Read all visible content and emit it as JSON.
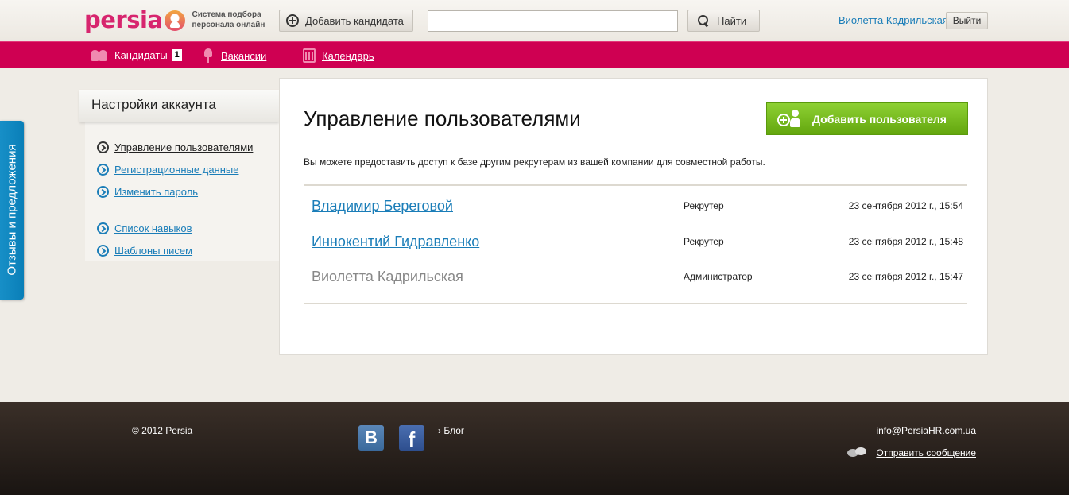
{
  "header": {
    "logo_text": "persia",
    "tagline_line1": "Система подбора",
    "tagline_line2": "персонала онлайн",
    "add_candidate_label": "Добавить кандидата",
    "search_value": "",
    "search_button_label": "Найти",
    "user_name": "Виолетта Кадрильская",
    "logout_label": "Выйти"
  },
  "nav": {
    "items": [
      {
        "label": "Кандидаты",
        "icon": "people-icon",
        "badge": "1"
      },
      {
        "label": "Вакансии",
        "icon": "chair-icon"
      },
      {
        "label": "Календарь",
        "icon": "calendar-icon"
      }
    ]
  },
  "feedback_tab": "Отзывы и предложения",
  "sidebar": {
    "title": "Настройки аккаунта",
    "items": [
      {
        "label": "Управление пользователями",
        "current": true
      },
      {
        "label": "Регистрационные данные"
      },
      {
        "label": "Изменить пароль"
      },
      {
        "label": "Список навыков"
      },
      {
        "label": "Шаблоны писем"
      }
    ]
  },
  "main": {
    "title": "Управление пользователями",
    "add_user_label": "Добавить пользователя",
    "intro": "Вы можете предоставить доступ к базе другим рекрутерам из вашей компании для совместной работы.",
    "users": [
      {
        "name": "Владимир Береговой",
        "role": "Рекрутер",
        "date": "23 сентября 2012 г., 15:54"
      },
      {
        "name": "Иннокентий Гидравленко",
        "role": "Рекрутер",
        "date": "23 сентября 2012 г., 15:48"
      },
      {
        "name": "Виолетта Кадрильская",
        "role": "Администратор",
        "date": "23 сентября 2012 г., 15:47"
      }
    ]
  },
  "footer": {
    "copyright": "© 2012 Persia",
    "vk_label": "B",
    "fb_label": "f",
    "blog_label": "Блог",
    "email": "info@PersiaHR.com.ua",
    "send_message": "Отправить сообщение"
  }
}
